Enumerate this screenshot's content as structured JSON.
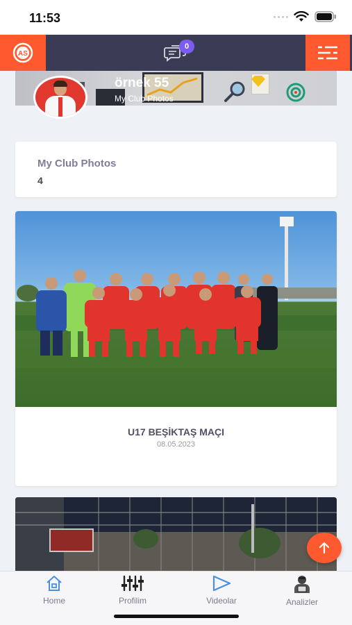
{
  "status_bar": {
    "time": "11:53"
  },
  "header": {
    "messages_badge": "0",
    "accent_color": "#ff5a2f",
    "header_color": "#3a3b55",
    "badge_color": "#7a5cf0"
  },
  "profile": {
    "name": "örnek 55",
    "subtitle": "My Club Photos"
  },
  "stats": {
    "title": "My Club Photos",
    "count": "4"
  },
  "photos": [
    {
      "title": "U17 BEŞİKTAŞ MAÇI",
      "date": "08.05.2023"
    }
  ],
  "tabbar": {
    "items": [
      {
        "label": "Home",
        "icon": "home-icon"
      },
      {
        "label": "Profilim",
        "icon": "sliders-icon"
      },
      {
        "label": "Videolar",
        "icon": "play-icon"
      },
      {
        "label": "Analizler",
        "icon": "analyst-icon"
      }
    ]
  }
}
